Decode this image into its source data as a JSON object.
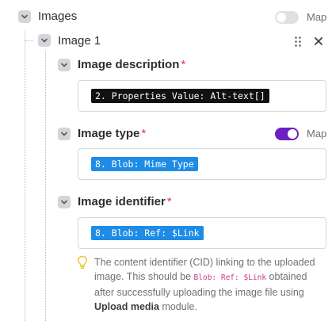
{
  "images_section": {
    "label": "Images",
    "map_label": "Map",
    "map_enabled": false
  },
  "item": {
    "label": "Image 1"
  },
  "fields": {
    "description": {
      "label": "Image description",
      "required_mark": "*",
      "value": "2. Properties Value: Alt-text[]"
    },
    "type": {
      "label": "Image type",
      "required_mark": "*",
      "map_label": "Map",
      "map_enabled": true,
      "value": "8. Blob: Mime Type"
    },
    "identifier": {
      "label": "Image identifier",
      "required_mark": "*",
      "value": "8. Blob: Ref: $Link"
    }
  },
  "hint": {
    "part1": "The content identifier (CID) linking to the uploaded image. This should be ",
    "code": "Blob: Ref: $Link",
    "part2": " obtained after successfully uploading the image file using ",
    "bold": "Upload media",
    "part3": " module."
  },
  "colors": {
    "toggle_on": "#6d1fc5",
    "pill_blue": "#1e8ce6",
    "pill_dark": "#111111",
    "required": "#e2323a"
  },
  "icons": [
    "chevron-down-icon",
    "drag-handle-icon",
    "close-icon",
    "lightbulb-icon"
  ]
}
